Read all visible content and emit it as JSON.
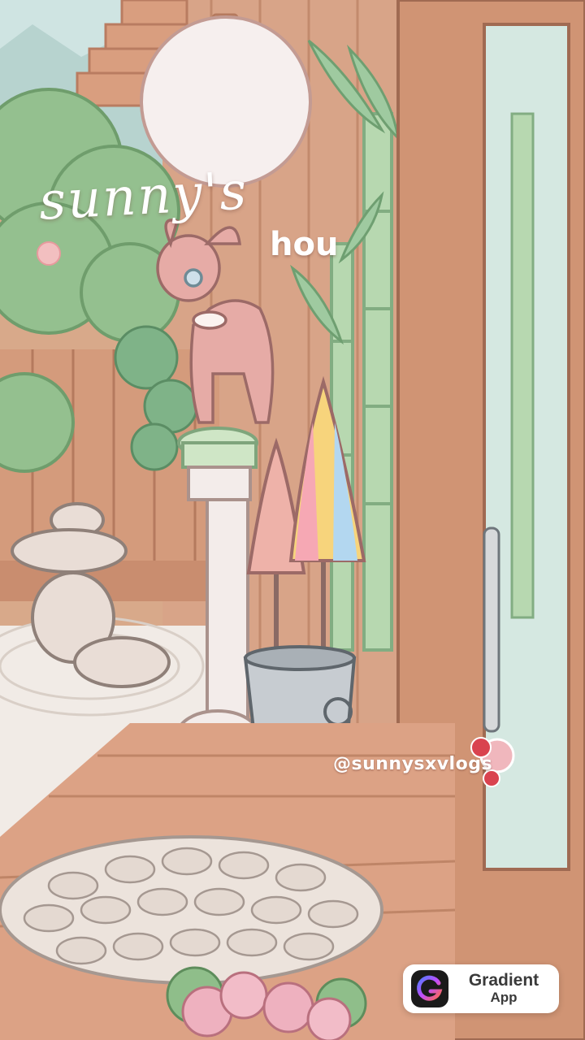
{
  "overlay": {
    "title": "sunny's",
    "subtitle": "hou",
    "handle": "@sunnysxvlogs"
  },
  "badge": {
    "name": "Gradient",
    "sub": "App",
    "icon": "gradient-app-icon"
  },
  "colors": {
    "wall": "#d8a98a",
    "wood_floor": "#d9a083",
    "bamboo": "#a9cfa9",
    "bush": "#8fbe8a",
    "deer": "#e6a9a4"
  }
}
